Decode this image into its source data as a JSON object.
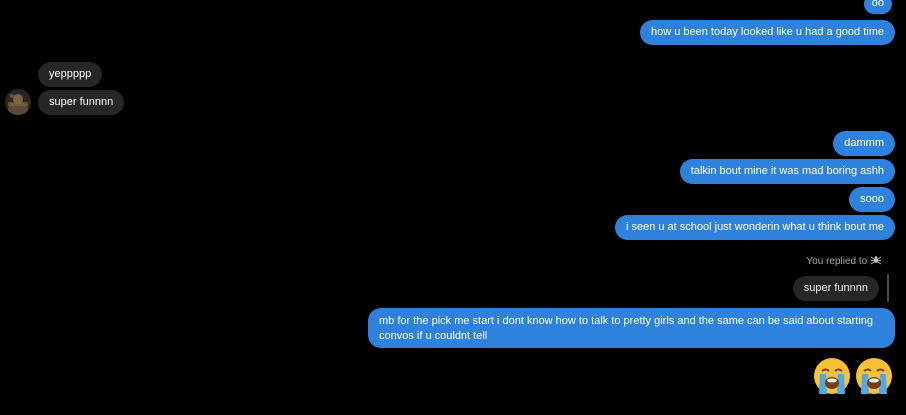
{
  "messages": {
    "m1": "oo",
    "m2": "how u been today looked like u had a good time",
    "m3": "yeppppp",
    "m4": "super funnnn",
    "m5": "dammm",
    "m6": "talkin bout mine it was mad boring ashh",
    "m7": "sooo",
    "m8": "i seen u at school just wonderin what u think bout me",
    "m9": "mb for the pick me start i dont know how to talk to pretty girls and the same can be said about starting convos if u couldnt tell"
  },
  "reply": {
    "label": "You replied to",
    "quoted_text": "super funnnn"
  },
  "emoji": {
    "message": [
      "loudly-crying-face",
      "loudly-crying-face"
    ]
  },
  "colors": {
    "background": "#000000",
    "outgoing_bubble": "#2e82dd",
    "incoming_bubble": "#262626"
  }
}
